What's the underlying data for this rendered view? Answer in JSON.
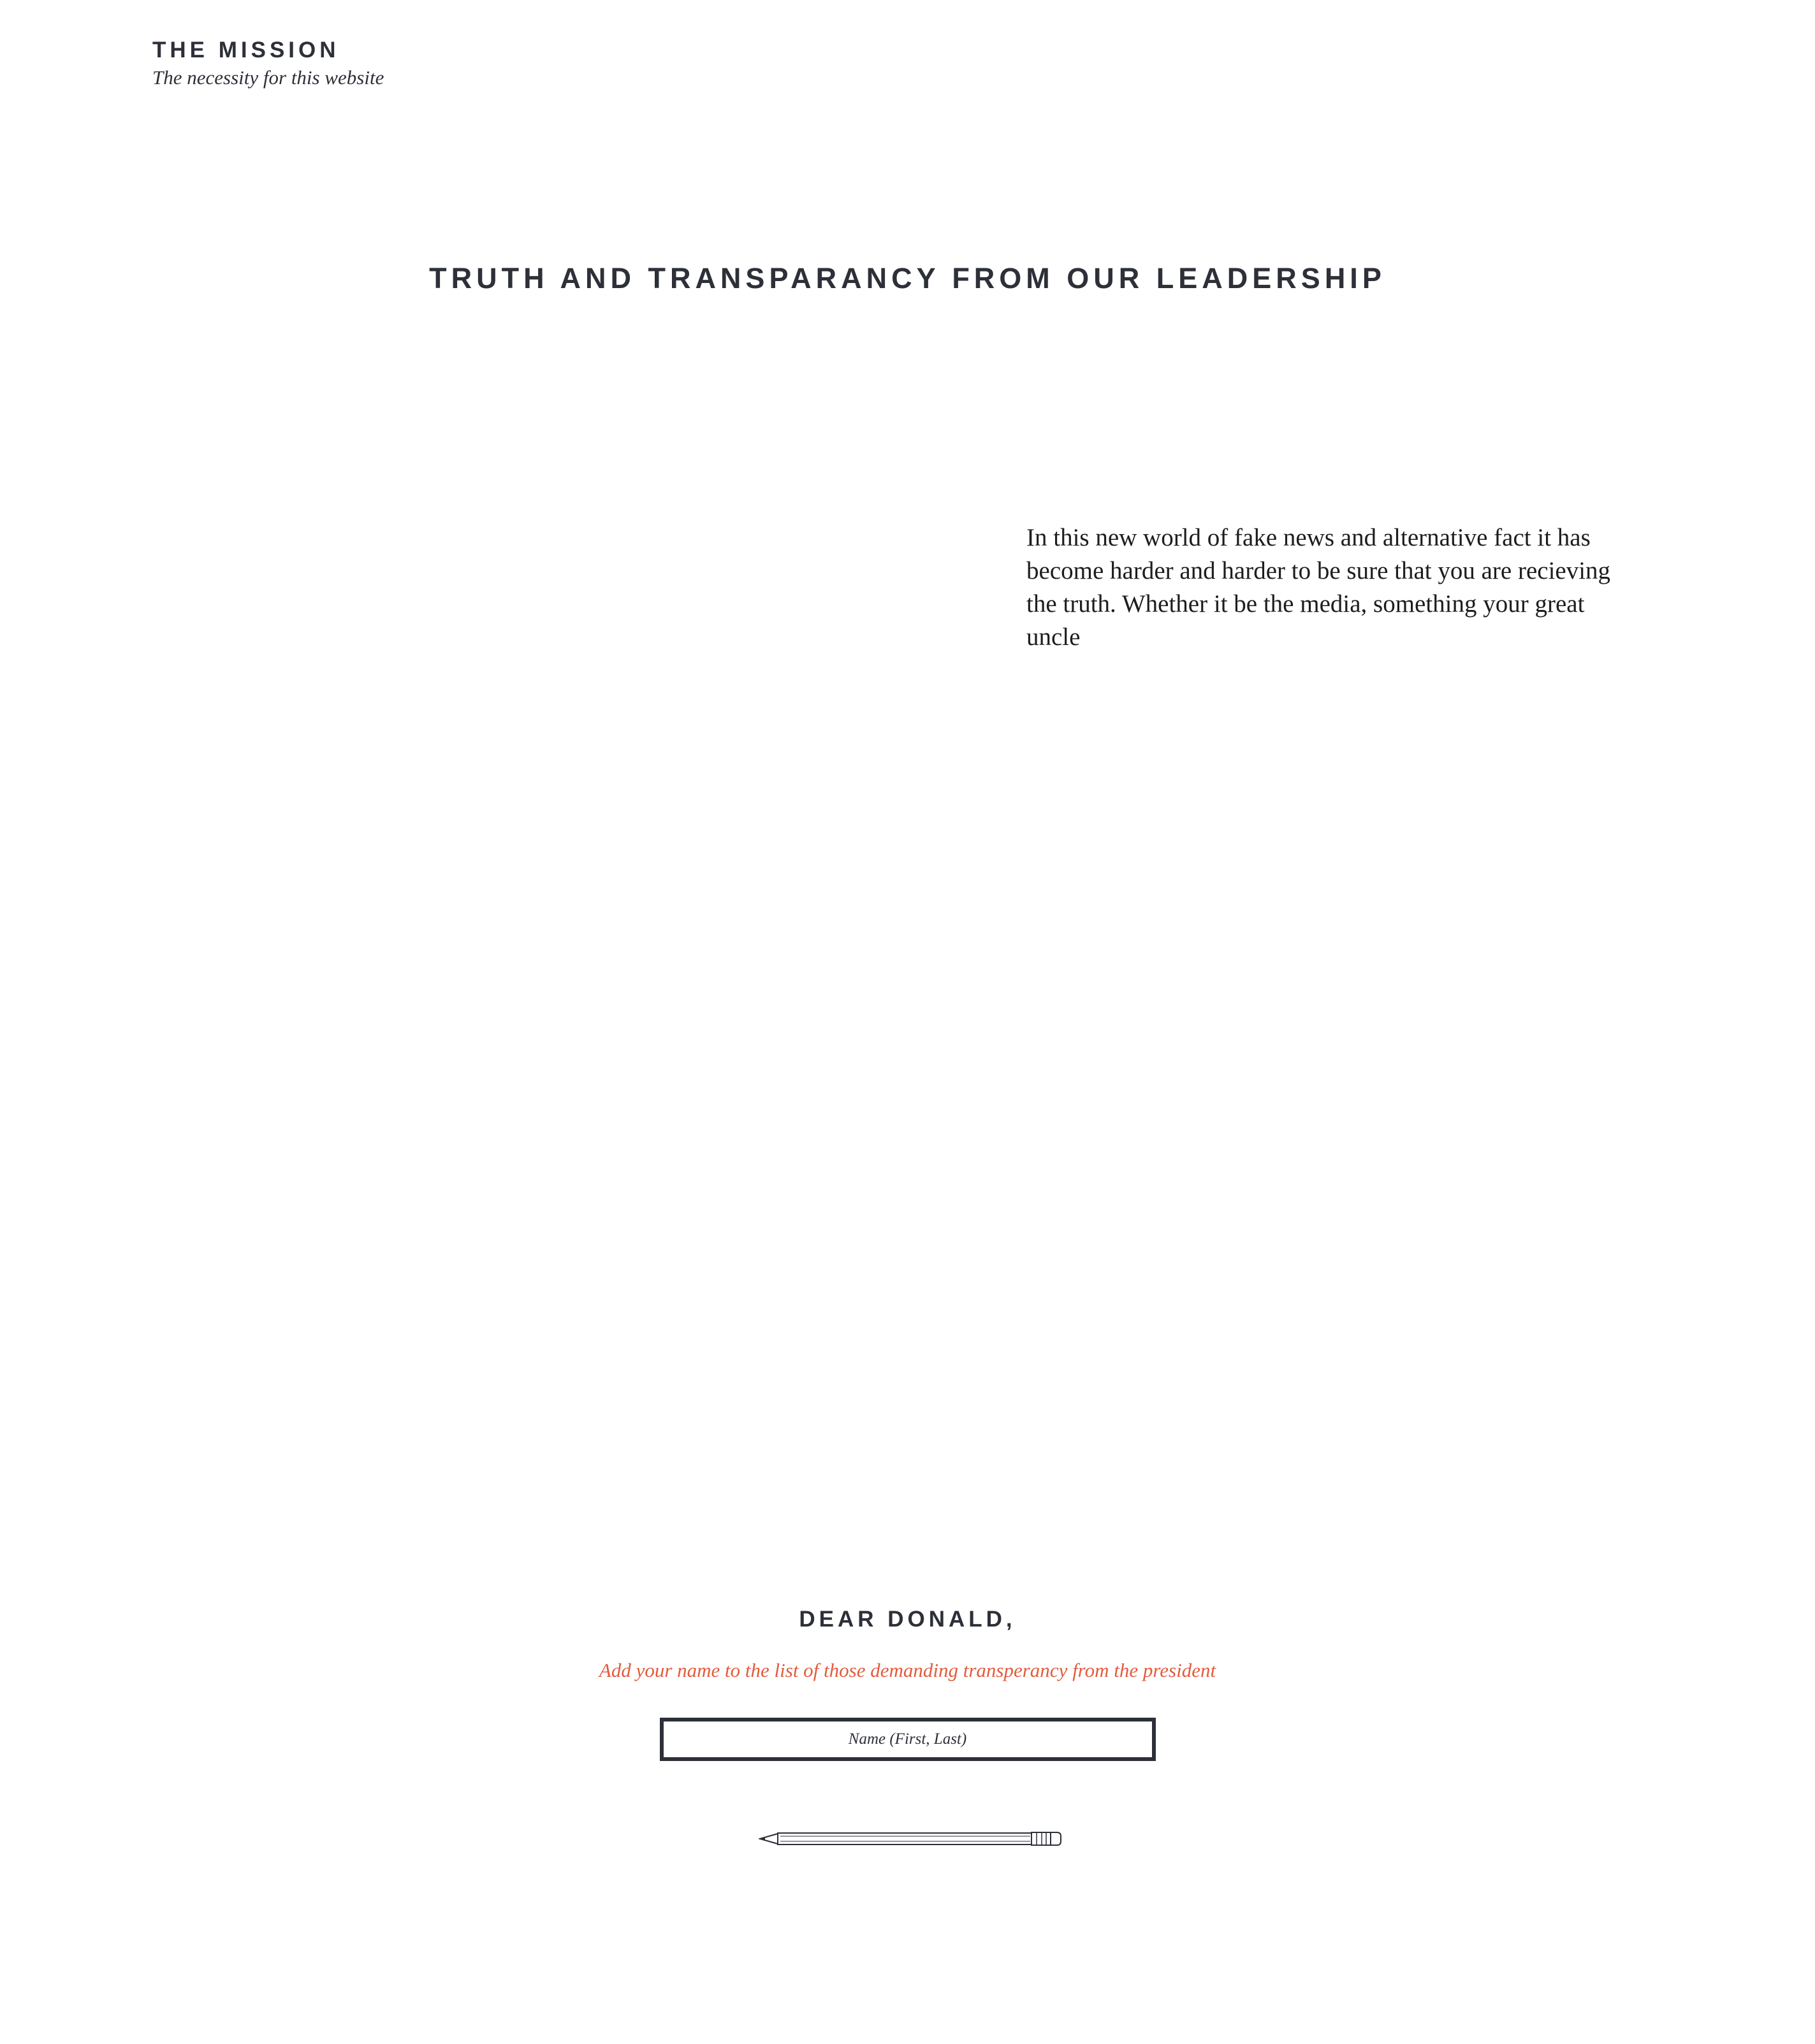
{
  "header": {
    "title": "THE MISSION",
    "subtitle": "The necessity for this website"
  },
  "main": {
    "heading": "TRUTH AND TRANSPARANCY FROM OUR LEADERSHIP",
    "intro": "In this new world of fake news and alternative fact it has become harder and harder to be sure that you are recieving the truth. Whether it be the media, something your great uncle"
  },
  "petition": {
    "title": "DEAR DONALD,",
    "subtitle": "Add your name to the list of those demanding transperancy from the president",
    "name_placeholder": "Name (First, Last)",
    "name_value": "",
    "submit_icon": "pencil-icon"
  },
  "colors": {
    "text_dark": "#2d3038",
    "accent": "#e35b3d",
    "background": "#ffffff"
  }
}
